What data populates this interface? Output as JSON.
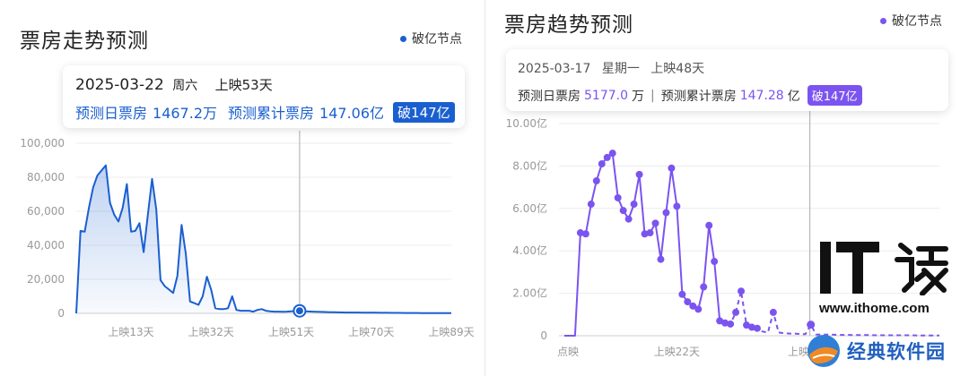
{
  "left": {
    "title": "票房走势预测",
    "legend": "破亿节点",
    "accent": "#1a5fd0",
    "tooltip": {
      "date": "2025-03-22",
      "weekday": "周六",
      "day_label": "上映53天",
      "daily_label": "预测日票房",
      "daily_value": "1467.2万",
      "total_label": "预测累计票房",
      "total_value": "147.06亿",
      "badge": "破147亿"
    }
  },
  "right": {
    "title": "票房趋势预测",
    "legend": "破亿节点",
    "accent": "#7b54f0",
    "tooltip": {
      "date": "2025-03-17",
      "weekday": "星期一",
      "day_label": "上映48天",
      "daily_label": "预测日票房",
      "daily_value": "5177.0",
      "daily_unit": "万",
      "separator": "|",
      "total_label": "预测累计票房",
      "total_value": "147.28",
      "total_unit": "亿",
      "badge": "破147亿"
    }
  },
  "watermark": {
    "it_text": "IT之家",
    "url": "www.ithome.com",
    "site_name": "经典软件园"
  },
  "chart_data": [
    {
      "type": "area",
      "ylim": [
        0,
        100000
      ],
      "y_ticks": [
        0,
        20000,
        40000,
        60000,
        80000,
        100000
      ],
      "y_tick_labels": [
        "0",
        "20,000",
        "40,000",
        "60,000",
        "80,000",
        "100,000"
      ],
      "x_ticks": [
        13,
        32,
        51,
        70,
        89
      ],
      "x_tick_labels": [
        "上映13天",
        "上映32天",
        "上映51天",
        "上映70天",
        "上映89天"
      ],
      "highlight_day": 53,
      "series": [
        {
          "x": [
            1,
            2,
            3,
            4,
            5,
            6,
            7,
            8,
            9,
            10,
            11,
            12,
            13,
            14,
            15,
            16,
            17,
            18,
            19,
            20,
            21,
            22,
            23,
            24,
            25,
            26,
            27,
            28,
            29,
            30,
            31,
            32,
            33,
            34,
            35,
            36,
            37,
            38,
            39,
            40,
            41,
            42,
            43,
            44,
            45,
            46,
            47,
            48,
            49,
            50,
            51,
            52,
            53,
            54,
            55,
            56,
            57,
            58,
            59,
            60,
            61,
            62,
            63,
            64,
            65,
            66,
            67,
            68,
            69,
            70,
            71,
            72,
            73,
            74,
            75,
            76,
            77,
            78,
            79,
            80,
            81,
            82,
            83,
            84,
            85,
            86,
            87,
            88,
            89
          ],
          "values": [
            48500,
            48000,
            62000,
            74000,
            81000,
            84000,
            87000,
            65000,
            58000,
            54000,
            62000,
            76000,
            48000,
            48500,
            53000,
            36000,
            58000,
            79000,
            61000,
            19500,
            16000,
            14000,
            12000,
            22000,
            52000,
            35000,
            7000,
            6000,
            5000,
            10000,
            21500,
            14000,
            3000,
            2500,
            2500,
            3000,
            10000,
            2000,
            1500,
            1500,
            1500,
            1000,
            2000,
            2500,
            1500,
            1200,
            1000,
            1000,
            900,
            1000,
            1200,
            1300,
            1467,
            1200,
            1100,
            1000,
            900,
            850,
            800,
            700,
            650,
            600,
            550,
            500,
            500,
            450,
            450,
            400,
            400,
            350,
            350,
            300,
            300,
            300,
            250,
            250,
            250,
            200,
            200,
            200,
            200,
            150,
            150,
            150,
            150,
            100,
            100,
            100,
            100
          ]
        }
      ]
    },
    {
      "type": "line",
      "ylim": [
        0,
        10
      ],
      "y_ticks": [
        0,
        2,
        4,
        6,
        8,
        10
      ],
      "y_tick_labels": [
        "0",
        "2.00亿",
        "4.00亿",
        "6.00亿",
        "8.00亿",
        "10.00亿"
      ],
      "x_ticks": [
        1,
        22,
        47
      ],
      "x_tick_labels": [
        "点映",
        "上映22天",
        "上映47天"
      ],
      "highlight_day": 48,
      "series": [
        {
          "x": [
            1,
            2,
            3,
            4,
            5,
            6,
            7,
            8,
            9,
            10,
            11,
            12,
            13,
            14,
            15,
            16,
            17,
            18,
            19,
            20,
            21,
            22,
            23,
            24,
            25,
            26,
            27,
            28,
            29,
            30,
            31,
            32,
            33,
            34,
            35,
            36,
            37,
            38,
            39,
            40,
            41,
            42,
            43,
            44,
            45,
            46,
            47,
            48,
            49,
            50,
            51,
            52,
            53,
            54,
            55,
            56,
            57,
            58,
            59,
            60,
            61,
            62,
            63,
            64,
            65,
            66,
            67,
            68,
            69,
            70,
            71
          ],
          "values": [
            0,
            0,
            0,
            4.85,
            4.8,
            6.2,
            7.3,
            8.1,
            8.4,
            8.6,
            6.5,
            5.9,
            5.5,
            6.2,
            7.6,
            4.8,
            4.85,
            5.3,
            3.6,
            5.8,
            7.9,
            6.1,
            1.95,
            1.6,
            1.4,
            1.25,
            2.3,
            5.2,
            3.5,
            0.7,
            0.6,
            0.55,
            1.1,
            2.1,
            0.5,
            0.4,
            0.35,
            0.2,
            0.15,
            1.1,
            0.15,
            0.12,
            0.1,
            0.1,
            0.08,
            0.07,
            0.52,
            0.06,
            0.05,
            0.05,
            0.05,
            0.04,
            0.04,
            0.04,
            0.03,
            0.03,
            0.03,
            0.03,
            0.02,
            0.02,
            0.02,
            0.02,
            0.02,
            0.02,
            0.02,
            0.02,
            0.01,
            0.01,
            0.01,
            0.01,
            0.01
          ]
        }
      ]
    }
  ]
}
